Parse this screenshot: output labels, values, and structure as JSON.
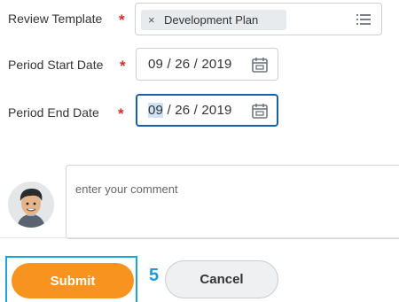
{
  "form": {
    "review_template": {
      "label": "Review Template",
      "required_mark": "*",
      "selected_item": "Development Plan",
      "remove_glyph": "×"
    },
    "period_start": {
      "label": "Period Start Date",
      "required_mark": "*",
      "month": "09",
      "rest": " / 26 / 2019"
    },
    "period_end": {
      "label": "Period End Date",
      "required_mark": "*",
      "month": "09",
      "rest": " / 26 / 2019"
    }
  },
  "comment": {
    "placeholder": "enter your comment"
  },
  "actions": {
    "submit_label": "Submit",
    "step_number": "5",
    "cancel_label": "Cancel"
  },
  "colors": {
    "required": "#de2a2a",
    "submit": "#f7931e",
    "focus_border": "#1c5fa8",
    "step_annotation": "#1f9ad6"
  },
  "icons": {
    "prompt_list": "list-icon",
    "date_picker": "calendar-icon",
    "user": "avatar"
  }
}
